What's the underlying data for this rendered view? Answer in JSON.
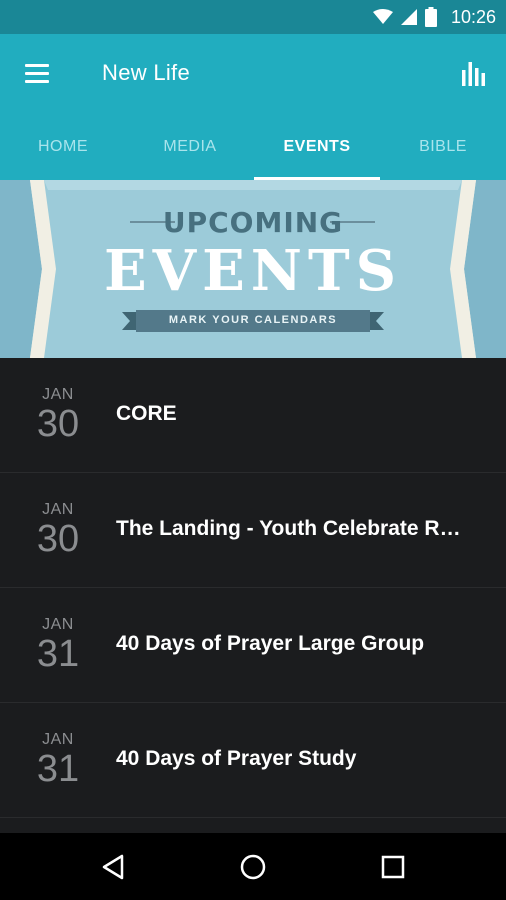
{
  "status_bar": {
    "time": "10:26",
    "icons": [
      "wifi-icon",
      "signal-icon",
      "battery-icon"
    ]
  },
  "app_bar": {
    "title": "New Life",
    "menu_icon": "hamburger-menu-icon",
    "action_icon": "bar-chart-icon"
  },
  "tabs": [
    {
      "label": "HOME",
      "active": false
    },
    {
      "label": "MEDIA",
      "active": false
    },
    {
      "label": "EVENTS",
      "active": true
    },
    {
      "label": "BIBLE",
      "active": false
    }
  ],
  "banner": {
    "heading": "UPCOMING",
    "title": "EVENTS",
    "ribbon": "MARK YOUR CALENDARS"
  },
  "events": [
    {
      "month": "JAN",
      "day": "30",
      "title": "CORE"
    },
    {
      "month": "JAN",
      "day": "30",
      "title": "The Landing - Youth Celebrate R…"
    },
    {
      "month": "JAN",
      "day": "31",
      "title": "40 Days of Prayer Large Group"
    },
    {
      "month": "JAN",
      "day": "31",
      "title": "40 Days of Prayer Study"
    }
  ],
  "nav_bar": {
    "icons": [
      "back-icon",
      "home-icon",
      "recents-icon"
    ]
  },
  "colors": {
    "status_bar": "#1a8796",
    "app_bar": "#21adbf",
    "tab_inactive": "#a9e4ec",
    "list_background": "#1b1c1e",
    "banner_blue": "#8fc6d6",
    "banner_text": "#4a6a78"
  }
}
